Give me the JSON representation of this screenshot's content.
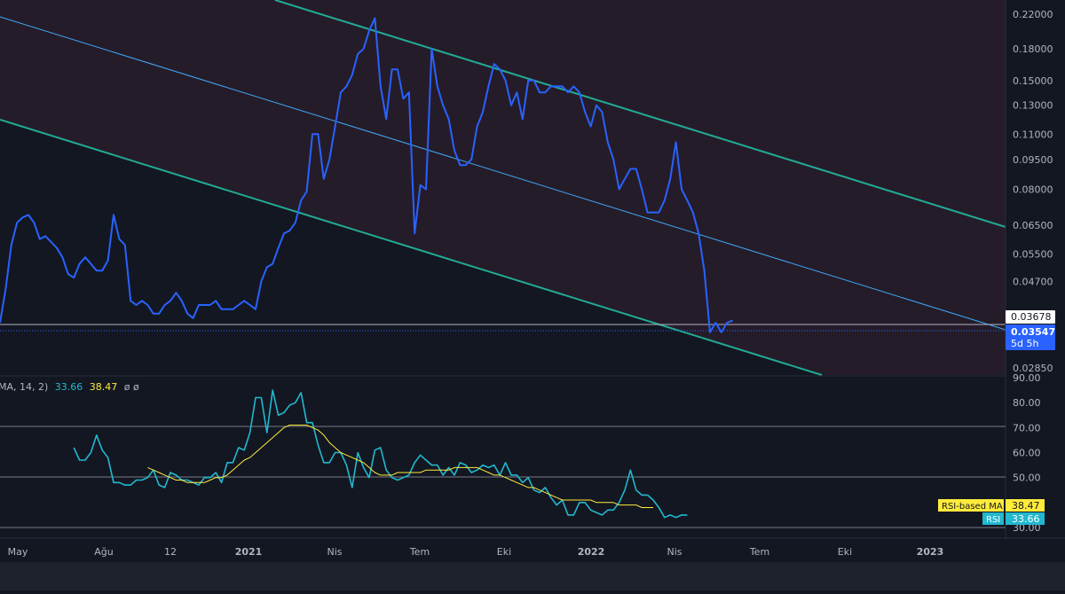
{
  "colors": {
    "background": "#131722",
    "channel_fill": "#251c2a",
    "channel_line": "#22ab94",
    "mid_line": "#3fa9f5",
    "price_line": "#2962ff",
    "rsi_line": "#22b8cf",
    "rsi_ma": "#ffeb3b",
    "axis_text": "#b2b5be",
    "grid": "#363a45",
    "last_price_label": "#2962ff",
    "level_label_bg": "#ffffff"
  },
  "price_axis": {
    "ticks": [
      "0.22000",
      "0.18000",
      "0.15000",
      "0.13000",
      "0.11000",
      "0.09500",
      "0.08000",
      "0.06500",
      "0.05500",
      "0.04700",
      "0.02850"
    ],
    "tick_values": [
      0.22,
      0.18,
      0.15,
      0.13,
      0.11,
      0.095,
      0.08,
      0.065,
      0.055,
      0.047,
      0.0285
    ],
    "level_label": "0.03678",
    "level_value": 0.03678,
    "last_price_label": "0.03547",
    "last_price_value": 0.03547,
    "countdown": "5d 5h",
    "scale": "log"
  },
  "rsi_axis": {
    "ticks": [
      "90.00",
      "80.00",
      "70.00",
      "60.00",
      "50.00",
      "30.00"
    ],
    "tick_values": [
      90,
      80,
      70,
      60,
      50,
      30
    ],
    "ma_label": "RSI-based MA",
    "ma_value": "38.47",
    "rsi_label": "RSI",
    "rsi_value": "33.66"
  },
  "rsi_legend": {
    "prefix": "MA, 14, 2)",
    "rsi": "33.66",
    "ma": "38.47",
    "extra": "ø ø"
  },
  "time_axis": {
    "labels": [
      "May",
      "Ağu",
      "12",
      "2021",
      "Nis",
      "Tem",
      "Eki",
      "2022",
      "Nis",
      "Tem",
      "Eki",
      "2023"
    ],
    "bold": [
      "2021",
      "2022",
      "2023"
    ]
  },
  "chart_data": [
    {
      "type": "line",
      "panel": "price",
      "y_scale": "log",
      "ylim": [
        0.0265,
        0.235
      ],
      "x_index_range": [
        0,
        130
      ],
      "values": [
        0.037,
        0.045,
        0.058,
        0.066,
        0.068,
        0.069,
        0.066,
        0.06,
        0.061,
        0.059,
        0.057,
        0.054,
        0.049,
        0.048,
        0.052,
        0.054,
        0.052,
        0.05,
        0.05,
        0.053,
        0.069,
        0.06,
        0.058,
        0.042,
        0.041,
        0.042,
        0.041,
        0.039,
        0.039,
        0.041,
        0.042,
        0.044,
        0.042,
        0.039,
        0.038,
        0.041,
        0.041,
        0.041,
        0.042,
        0.04,
        0.04,
        0.04,
        0.041,
        0.042,
        0.041,
        0.04,
        0.047,
        0.051,
        0.052,
        0.057,
        0.062,
        0.063,
        0.066,
        0.075,
        0.079,
        0.11,
        0.11,
        0.085,
        0.095,
        0.115,
        0.14,
        0.145,
        0.155,
        0.175,
        0.18,
        0.2,
        0.215,
        0.145,
        0.12,
        0.16,
        0.16,
        0.135,
        0.14,
        0.062,
        0.082,
        0.08,
        0.18,
        0.145,
        0.13,
        0.12,
        0.1,
        0.092,
        0.092,
        0.095,
        0.115,
        0.125,
        0.145,
        0.165,
        0.16,
        0.15,
        0.13,
        0.14,
        0.12,
        0.15,
        0.15,
        0.14,
        0.14,
        0.145,
        0.145,
        0.145,
        0.14,
        0.145,
        0.14,
        0.125,
        0.115,
        0.13,
        0.125,
        0.105,
        0.095,
        0.08,
        0.085,
        0.09,
        0.09,
        0.08,
        0.07,
        0.07,
        0.07,
        0.075,
        0.085,
        0.105,
        0.08,
        0.075,
        0.07,
        0.062,
        0.05,
        0.035,
        0.037,
        0.035,
        0.037,
        0.0375
      ]
    },
    {
      "type": "line",
      "panel": "rsi",
      "ylim": [
        27,
        90
      ],
      "x_index_range": [
        13,
        119
      ],
      "values": [
        62,
        57,
        57,
        60,
        67,
        61,
        58,
        48,
        48,
        47,
        47,
        49,
        49,
        50,
        53,
        47,
        46,
        52,
        51,
        49,
        49,
        48,
        47,
        50,
        50,
        52,
        48,
        56,
        56,
        62,
        61,
        68,
        82,
        82,
        68,
        85,
        75,
        76,
        79,
        80,
        84,
        72,
        72,
        63,
        56,
        56,
        60,
        60,
        55,
        46,
        60,
        54,
        50,
        61,
        62,
        53,
        50,
        49,
        50,
        51,
        56,
        59,
        57,
        55,
        55,
        51,
        54,
        51,
        56,
        55,
        52,
        53,
        55,
        54,
        55,
        51,
        56,
        51,
        51,
        48,
        50,
        45,
        44,
        46,
        42,
        39,
        41,
        35,
        35,
        40,
        40,
        37,
        36,
        35,
        37,
        37,
        40,
        45,
        53,
        45,
        43,
        43,
        41,
        38,
        34,
        35,
        34,
        35,
        35
      ]
    },
    {
      "type": "line",
      "panel": "rsi",
      "name": "RSI-based MA",
      "ylim": [
        27,
        90
      ],
      "x_index_range": [
        26,
        119
      ],
      "values": [
        54,
        53,
        52,
        51,
        50,
        49,
        49,
        48,
        48,
        48,
        48,
        49,
        50,
        50,
        51,
        53,
        55,
        57,
        58,
        60,
        62,
        64,
        66,
        68,
        70,
        71,
        71,
        71,
        71,
        70,
        69,
        67,
        64,
        62,
        60,
        59,
        58,
        57,
        56,
        54,
        52,
        51,
        51,
        51,
        52,
        52,
        52,
        52,
        52,
        53,
        53,
        53,
        53,
        53,
        54,
        54,
        54,
        54,
        54,
        53,
        52,
        51,
        51,
        50,
        49,
        48,
        47,
        46,
        46,
        45,
        44,
        43,
        42,
        41,
        41,
        41,
        41,
        41,
        41,
        40,
        40,
        40,
        40,
        39,
        39,
        39,
        39,
        38,
        38,
        38
      ]
    }
  ]
}
